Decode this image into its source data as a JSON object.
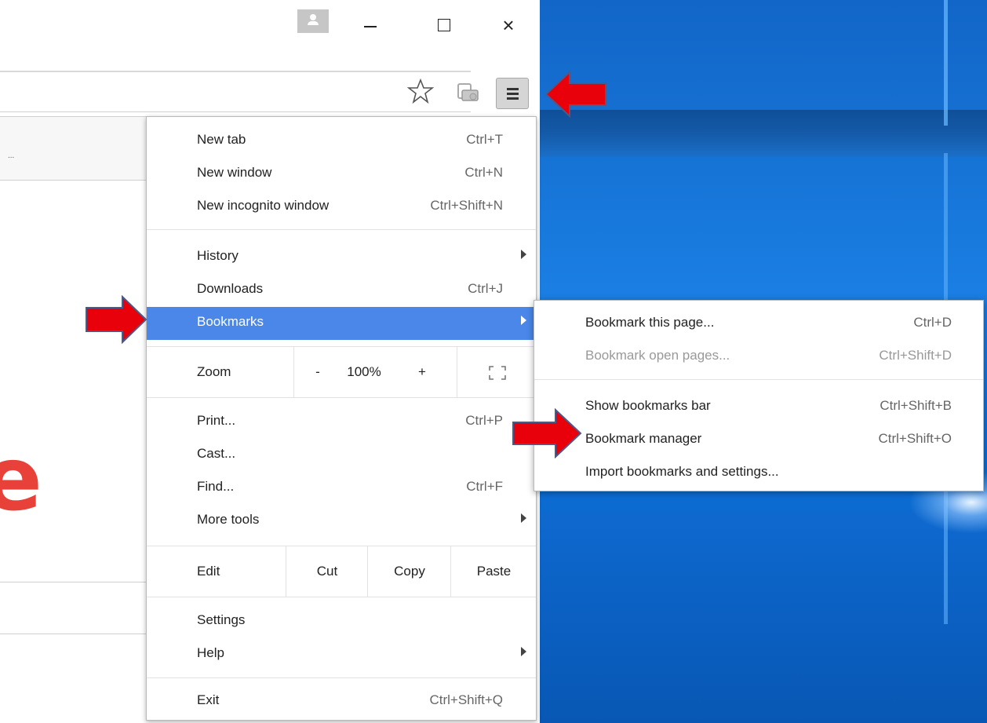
{
  "window": {
    "minimize_glyph": "",
    "maximize_glyph": "",
    "close_glyph": "×"
  },
  "page_fragment": "e",
  "menu": {
    "group1": [
      {
        "label": "New tab",
        "shortcut": "Ctrl+T"
      },
      {
        "label": "New window",
        "shortcut": "Ctrl+N"
      },
      {
        "label": "New incognito window",
        "shortcut": "Ctrl+Shift+N"
      }
    ],
    "group2": [
      {
        "label": "History",
        "shortcut": ""
      },
      {
        "label": "Downloads",
        "shortcut": "Ctrl+J"
      },
      {
        "label": "Bookmarks",
        "shortcut": ""
      }
    ],
    "zoom": {
      "label": "Zoom",
      "minus": "-",
      "value": "100%",
      "plus": "+"
    },
    "group3": [
      {
        "label": "Print...",
        "shortcut": "Ctrl+P"
      },
      {
        "label": "Cast...",
        "shortcut": ""
      },
      {
        "label": "Find...",
        "shortcut": "Ctrl+F"
      },
      {
        "label": "More tools",
        "shortcut": ""
      }
    ],
    "edit": {
      "label": "Edit",
      "cut": "Cut",
      "copy": "Copy",
      "paste": "Paste"
    },
    "group4": [
      {
        "label": "Settings",
        "shortcut": ""
      },
      {
        "label": "Help",
        "shortcut": ""
      }
    ],
    "exit": {
      "label": "Exit",
      "shortcut": "Ctrl+Shift+Q"
    }
  },
  "bookmarks_submenu": [
    {
      "label": "Bookmark this page...",
      "shortcut": "Ctrl+D"
    },
    {
      "label": "Bookmark open pages...",
      "shortcut": "Ctrl+Shift+D"
    },
    {
      "label": "Show bookmarks bar",
      "shortcut": "Ctrl+Shift+B"
    },
    {
      "label": "Bookmark manager",
      "shortcut": "Ctrl+Shift+O"
    },
    {
      "label": "Import bookmarks and settings...",
      "shortcut": ""
    }
  ],
  "colors": {
    "highlight": "#4a87e8",
    "arrow": "#e8000b",
    "desktop": "#1a7ee2"
  }
}
